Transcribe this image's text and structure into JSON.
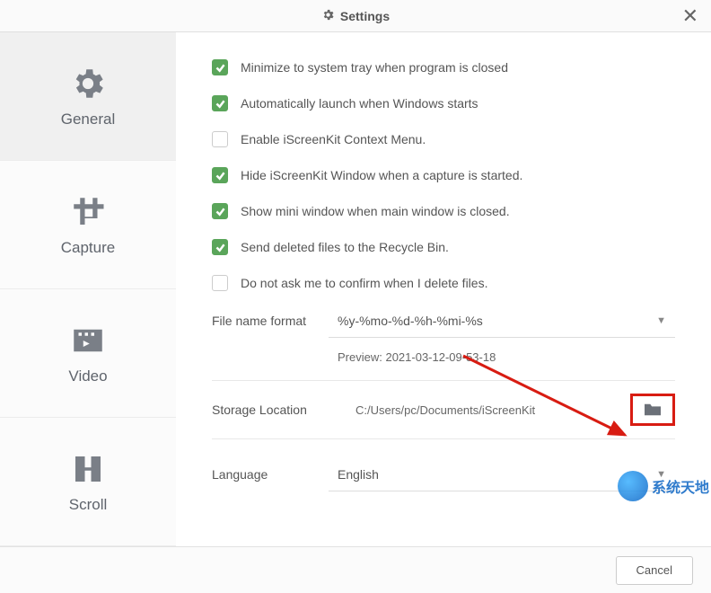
{
  "header": {
    "title": "Settings"
  },
  "sidebar": {
    "items": [
      {
        "label": "General"
      },
      {
        "label": "Capture"
      },
      {
        "label": "Video"
      },
      {
        "label": "Scroll"
      }
    ]
  },
  "options": {
    "minimize_tray": {
      "label": "Minimize to system tray when program is closed",
      "checked": true
    },
    "auto_launch": {
      "label": "Automatically launch when Windows starts",
      "checked": true
    },
    "context_menu": {
      "label": "Enable iScreenKit Context Menu.",
      "checked": false
    },
    "hide_window": {
      "label": "Hide iScreenKit Window when a capture is started.",
      "checked": true
    },
    "mini_window": {
      "label": "Show mini window when main window is closed.",
      "checked": true
    },
    "recycle_bin": {
      "label": "Send deleted files to the Recycle Bin.",
      "checked": true
    },
    "no_confirm": {
      "label": "Do not ask me to confirm when I delete files.",
      "checked": false
    }
  },
  "filename": {
    "label": "File name format",
    "value": "%y-%mo-%d-%h-%mi-%s",
    "preview_label": "Preview: 2021-03-12-09-53-18"
  },
  "storage": {
    "label": "Storage Location",
    "value": "C:/Users/pc/Documents/iScreenKit"
  },
  "language": {
    "label": "Language",
    "value": "English"
  },
  "footer": {
    "cancel": "Cancel"
  },
  "watermark": {
    "text": "系统天地"
  }
}
